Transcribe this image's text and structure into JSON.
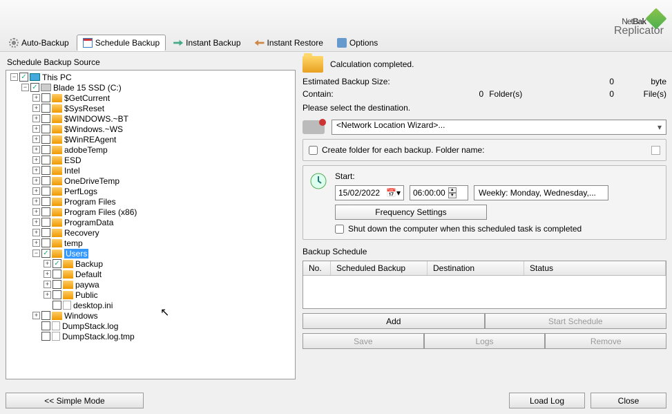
{
  "app": {
    "name_main": "Net",
    "name_bold": "Bak",
    "subtitle": "Replicator"
  },
  "toolbar": {
    "auto": "Auto-Backup",
    "schedule": "Schedule Backup",
    "instant": "Instant Backup",
    "restore": "Instant Restore",
    "options": "Options"
  },
  "left_panel": {
    "title": "Schedule Backup Source"
  },
  "tree": {
    "root": "This PC",
    "drive": "Blade 15 SSD (C:)",
    "folders_l1": [
      "$GetCurrent",
      "$SysReset",
      "$WINDOWS.~BT",
      "$Windows.~WS",
      "$WinREAgent",
      "adobeTemp",
      "ESD",
      "Intel",
      "OneDriveTemp",
      "PerfLogs",
      "Program Files",
      "Program Files (x86)",
      "ProgramData",
      "Recovery",
      "temp"
    ],
    "users": "Users",
    "users_children": [
      "Backup",
      "Default",
      "paywa",
      "Public"
    ],
    "users_file": "desktop.ini",
    "after_users": [
      "Windows"
    ],
    "files_after": [
      "DumpStack.log",
      "DumpStack.log.tmp"
    ]
  },
  "status": {
    "calc": "Calculation completed.",
    "est_label": "Estimated Backup Size:",
    "est_val": "0",
    "est_unit": "byte",
    "contain_label": "Contain:",
    "folders_val": "0",
    "folders_unit": "Folder(s)",
    "files_val": "0",
    "files_unit": "File(s)"
  },
  "dest": {
    "label": "Please select the destination.",
    "combo": "<Network Location Wizard>..."
  },
  "create_folder": {
    "label": "Create folder for each backup. Folder name:",
    "value": ""
  },
  "schedule": {
    "start_label": "Start:",
    "date": "15/02/2022",
    "time": "06:00:00",
    "weekly": "Weekly: Monday, Wednesday,...",
    "freq_btn": "Frequency Settings",
    "shutdown": "Shut down the computer when this scheduled task is completed"
  },
  "table": {
    "title": "Backup Schedule",
    "cols": {
      "no": "No.",
      "sb": "Scheduled Backup",
      "dest": "Destination",
      "status": "Status"
    }
  },
  "buttons": {
    "add": "Add",
    "start": "Start Schedule",
    "save": "Save",
    "logs": "Logs",
    "remove": "Remove",
    "simple": "<< Simple Mode",
    "loadlog": "Load Log",
    "close": "Close"
  }
}
